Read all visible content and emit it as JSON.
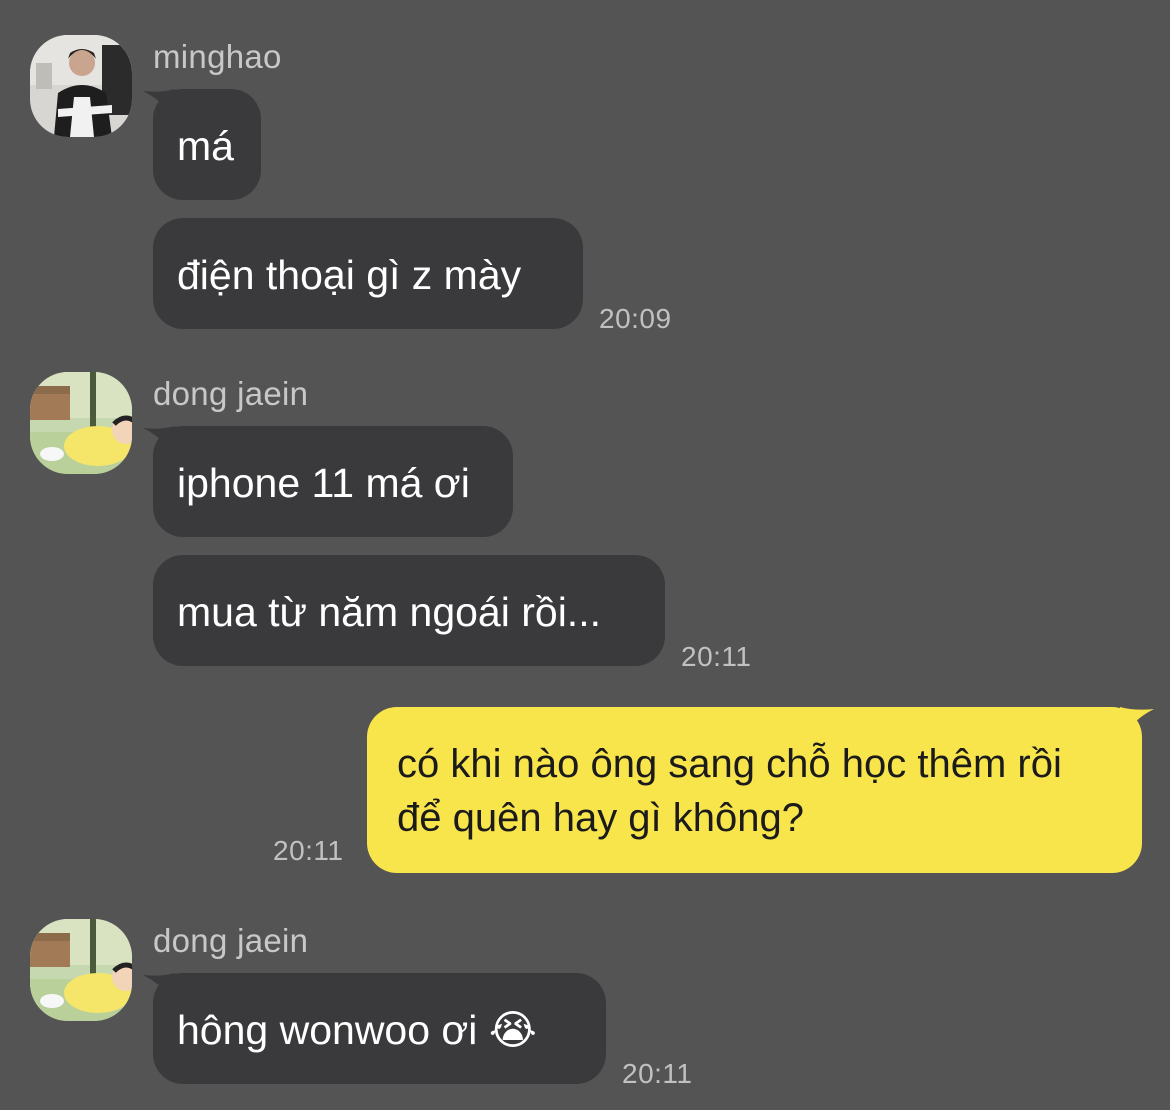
{
  "colors": {
    "background": "#555455",
    "incoming_bubble": "#3a393b",
    "outgoing_bubble": "#f8e54c",
    "sender_text": "#c9c8c9",
    "timestamp_text": "#c2c1c2"
  },
  "messages": [
    {
      "sender": "minghao",
      "avatar": "minghao-photo-avatar",
      "bubbles": [
        "má",
        "điện thoại gì z mày"
      ],
      "time": "20:09"
    },
    {
      "sender": "dong jaein",
      "avatar": "cartoon-character-avatar",
      "bubbles": [
        "iphone 11 má ơi",
        "mua từ năm ngoái rồi..."
      ],
      "time": "20:11"
    },
    {
      "sender": "me",
      "bubbles": [
        "có khi nào ông sang chỗ học thêm rồi để quên hay gì không?"
      ],
      "time": "20:11"
    },
    {
      "sender": "dong jaein",
      "avatar": "cartoon-character-avatar",
      "bubbles": [
        "hông wonwoo ơi"
      ],
      "emoji": "😭",
      "emoji_name": "loudly-crying-face-icon",
      "time": "20:11"
    }
  ]
}
